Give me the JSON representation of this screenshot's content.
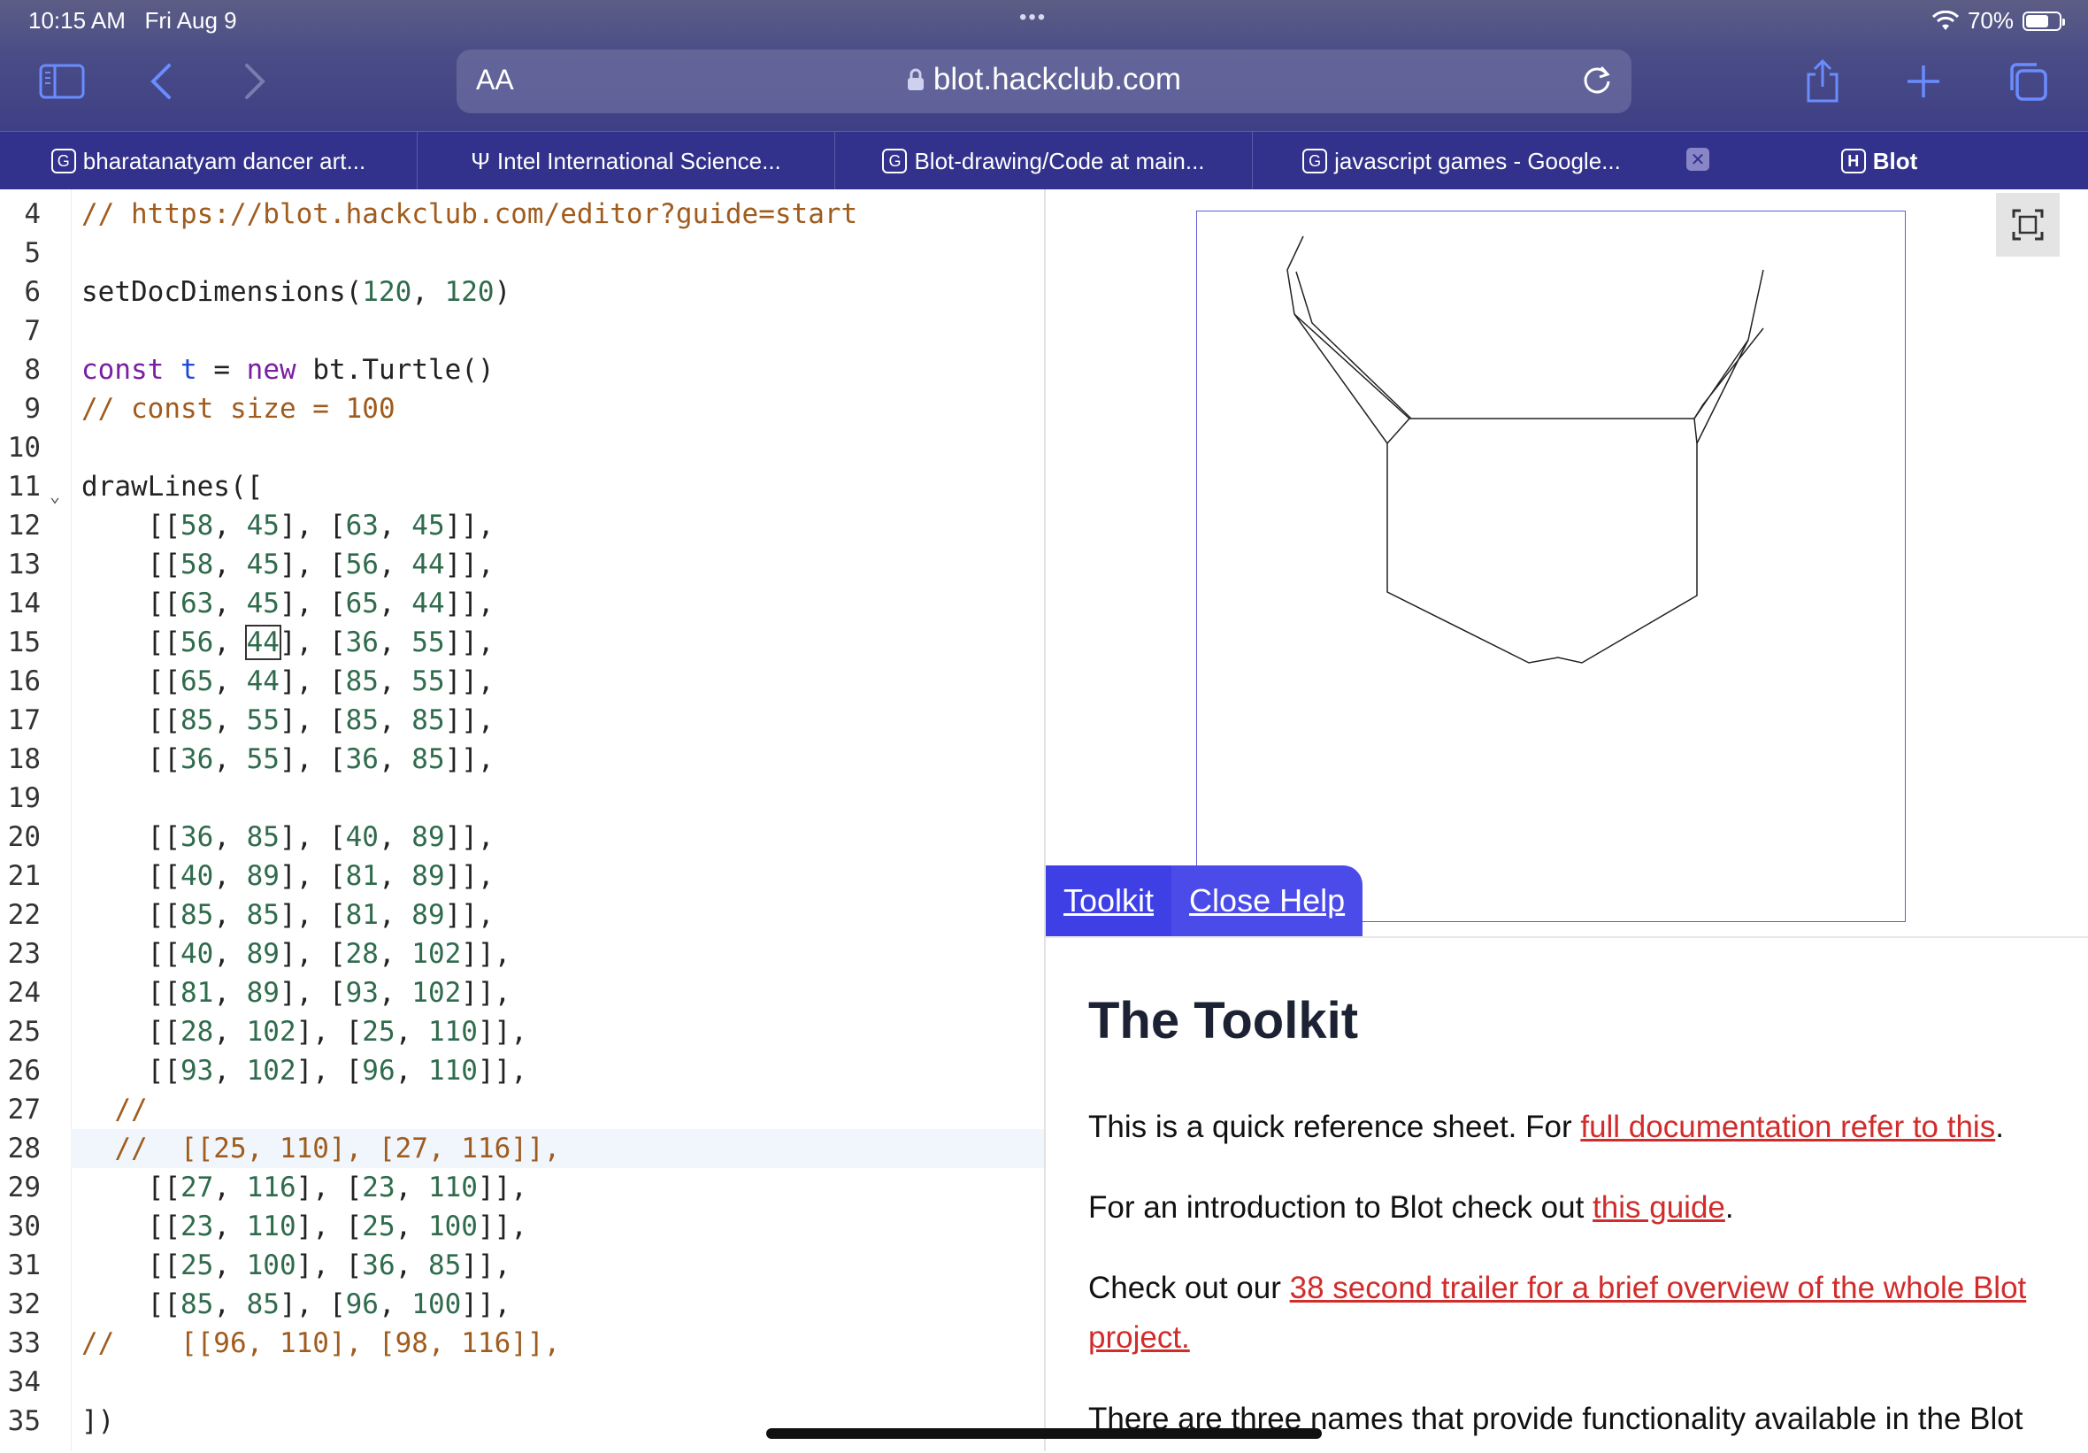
{
  "status": {
    "time": "10:15 AM",
    "date": "Fri Aug 9",
    "dots": "•••",
    "battery": "70%",
    "battery_level": 0.7
  },
  "toolbar": {
    "aa_label": "AA",
    "url": "blot.hackclub.com"
  },
  "tabs": [
    {
      "badge": "G",
      "label": "bharatanatyam dancer art..."
    },
    {
      "badge": "Ψ",
      "label": "Intel International Science..."
    },
    {
      "badge": "G",
      "label": "Blot-drawing/Code at main..."
    },
    {
      "badge": "G",
      "label": "javascript games - Google..."
    },
    {
      "badge": "H",
      "label": "Blot"
    }
  ],
  "editor": {
    "line_numbers": [
      "4",
      "5",
      "6",
      "7",
      "8",
      "9",
      "10",
      "11",
      "12",
      "13",
      "14",
      "15",
      "16",
      "17",
      "18",
      "19",
      "20",
      "21",
      "22",
      "23",
      "24",
      "25",
      "26",
      "27",
      "28",
      "29",
      "30",
      "31",
      "32",
      "33",
      "34",
      "35"
    ]
  },
  "help": {
    "tab_toolkit": "Toolkit",
    "tab_close": "Close Help",
    "title": "The Toolkit",
    "p1_text": "This is a quick reference sheet. For ",
    "p1_link": "full documentation refer to this",
    "p1_end": ".",
    "p2_text": "For an introduction to Blot check out ",
    "p2_link": "this guide",
    "p2_end": ".",
    "p3_text": "Check out our ",
    "p3_link": "38 second trailer for a brief overview of the whole Blot project.",
    "p4_text": "There are three names that provide functionality available in the Blot"
  },
  "colors": {
    "accent": "#3f3fe6",
    "link": "#d12c2c",
    "tabbar": "#32318c"
  }
}
